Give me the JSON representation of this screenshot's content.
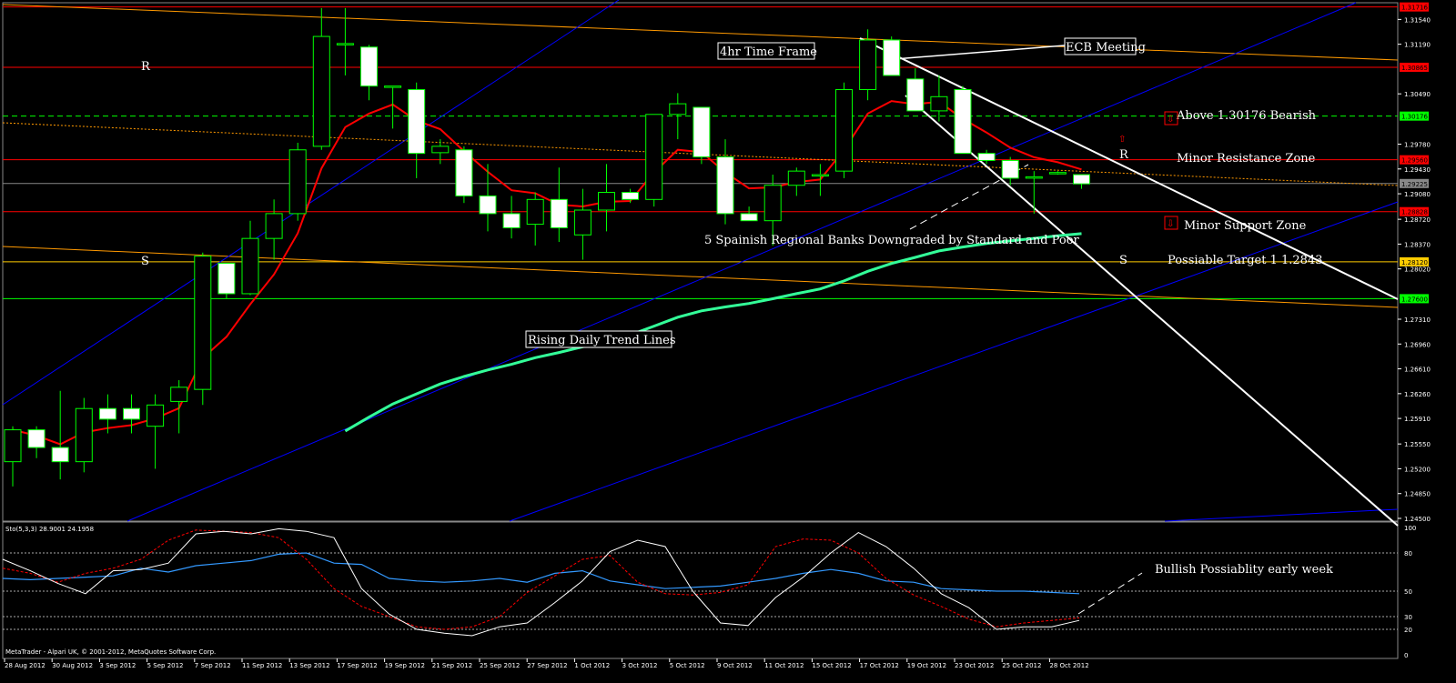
{
  "chart_data": {
    "type": "candlestick",
    "price_axis": {
      "ylim": [
        1.245,
        1.3175
      ],
      "tick_labels": [
        "1.31540",
        "1.31190",
        "1.30490",
        "1.29780",
        "1.29430",
        "1.29080",
        "1.28720",
        "1.28370",
        "1.28020",
        "1.27310",
        "1.26960",
        "1.26610",
        "1.26260",
        "1.25910",
        "1.25550",
        "1.25200",
        "1.24850",
        "1.24500"
      ],
      "tick_values": [
        1.3154,
        1.3119,
        1.3049,
        1.2978,
        1.2943,
        1.2908,
        1.2872,
        1.2837,
        1.2802,
        1.2731,
        1.2696,
        1.2661,
        1.2626,
        1.2591,
        1.2555,
        1.252,
        1.2485,
        1.245
      ],
      "level_tags": [
        {
          "text": "1.31716",
          "value": 1.31716,
          "color": "#ff0000"
        },
        {
          "text": "1.30865",
          "value": 1.30865,
          "color": "#ff0000"
        },
        {
          "text": "1.30176",
          "value": 1.30176,
          "color": "#00ff00"
        },
        {
          "text": "1.29560",
          "value": 1.2956,
          "color": "#ff0000"
        },
        {
          "text": "1.29225",
          "value": 1.29225,
          "color": "#888888"
        },
        {
          "text": "1.28828",
          "value": 1.28828,
          "color": "#ff0000"
        },
        {
          "text": "1.28120",
          "value": 1.2812,
          "color": "#ffcc00"
        },
        {
          "text": "1.27600",
          "value": 1.276,
          "color": "#00ff00"
        }
      ]
    },
    "x_tick_labels": [
      "28 Aug 2012",
      "30 Aug 2012",
      "3 Sep 2012",
      "5 Sep 2012",
      "7 Sep 2012",
      "11 Sep 2012",
      "13 Sep 2012",
      "17 Sep 2012",
      "19 Sep 2012",
      "21 Sep 2012",
      "25 Sep 2012",
      "27 Sep 2012",
      "1 Oct 2012",
      "3 Oct 2012",
      "5 Oct 2012",
      "9 Oct 2012",
      "11 Oct 2012",
      "15 Oct 2012",
      "17 Oct 2012",
      "19 Oct 2012",
      "23 Oct 2012",
      "25 Oct 2012",
      "28 Oct 2012"
    ],
    "candles": [
      {
        "o": 1.253,
        "h": 1.258,
        "l": 1.2495,
        "c": 1.2575
      },
      {
        "o": 1.2575,
        "h": 1.258,
        "l": 1.2535,
        "c": 1.255
      },
      {
        "o": 1.255,
        "h": 1.263,
        "l": 1.2505,
        "c": 1.253
      },
      {
        "o": 1.253,
        "h": 1.262,
        "l": 1.2515,
        "c": 1.2605
      },
      {
        "o": 1.2605,
        "h": 1.2625,
        "l": 1.257,
        "c": 1.259
      },
      {
        "o": 1.2605,
        "h": 1.2625,
        "l": 1.257,
        "c": 1.259
      },
      {
        "o": 1.258,
        "h": 1.2625,
        "l": 1.252,
        "c": 1.261
      },
      {
        "o": 1.2615,
        "h": 1.2645,
        "l": 1.257,
        "c": 1.2635
      },
      {
        "o": 1.2632,
        "h": 1.2825,
        "l": 1.261,
        "c": 1.282
      },
      {
        "o": 1.281,
        "h": 1.281,
        "l": 1.276,
        "c": 1.2767
      },
      {
        "o": 1.2767,
        "h": 1.287,
        "l": 1.2765,
        "c": 1.2845
      },
      {
        "o": 1.2845,
        "h": 1.29,
        "l": 1.2815,
        "c": 1.288
      },
      {
        "o": 1.288,
        "h": 1.298,
        "l": 1.287,
        "c": 1.297
      },
      {
        "o": 1.2975,
        "h": 1.317,
        "l": 1.297,
        "c": 1.313
      },
      {
        "o": 1.312,
        "h": 1.317,
        "l": 1.3075,
        "c": 1.312
      },
      {
        "o": 1.3115,
        "h": 1.3118,
        "l": 1.304,
        "c": 1.306
      },
      {
        "o": 1.306,
        "h": 1.306,
        "l": 1.3,
        "c": 1.306
      },
      {
        "o": 1.3055,
        "h": 1.3065,
        "l": 1.293,
        "c": 1.2965
      },
      {
        "o": 1.2966,
        "h": 1.2985,
        "l": 1.295,
        "c": 1.2975
      },
      {
        "o": 1.297,
        "h": 1.2975,
        "l": 1.2895,
        "c": 1.2905
      },
      {
        "o": 1.2905,
        "h": 1.295,
        "l": 1.2855,
        "c": 1.288
      },
      {
        "o": 1.288,
        "h": 1.2905,
        "l": 1.2845,
        "c": 1.286
      },
      {
        "o": 1.2865,
        "h": 1.291,
        "l": 1.2835,
        "c": 1.29
      },
      {
        "o": 1.29,
        "h": 1.2945,
        "l": 1.284,
        "c": 1.286
      },
      {
        "o": 1.285,
        "h": 1.2915,
        "l": 1.2815,
        "c": 1.2885
      },
      {
        "o": 1.2885,
        "h": 1.295,
        "l": 1.2855,
        "c": 1.291
      },
      {
        "o": 1.291,
        "h": 1.2915,
        "l": 1.2895,
        "c": 1.29
      },
      {
        "o": 1.29,
        "h": 1.302,
        "l": 1.289,
        "c": 1.302
      },
      {
        "o": 1.302,
        "h": 1.305,
        "l": 1.2985,
        "c": 1.3035
      },
      {
        "o": 1.303,
        "h": 1.303,
        "l": 1.295,
        "c": 1.296
      },
      {
        "o": 1.296,
        "h": 1.2985,
        "l": 1.2865,
        "c": 1.288
      },
      {
        "o": 1.288,
        "h": 1.289,
        "l": 1.287,
        "c": 1.287
      },
      {
        "o": 1.287,
        "h": 1.2935,
        "l": 1.2835,
        "c": 1.292
      },
      {
        "o": 1.292,
        "h": 1.2945,
        "l": 1.2905,
        "c": 1.294
      },
      {
        "o": 1.2935,
        "h": 1.295,
        "l": 1.2905,
        "c": 1.2935
      },
      {
        "o": 1.294,
        "h": 1.3065,
        "l": 1.293,
        "c": 1.3055
      },
      {
        "o": 1.3055,
        "h": 1.314,
        "l": 1.304,
        "c": 1.3125
      },
      {
        "o": 1.3125,
        "h": 1.313,
        "l": 1.3075,
        "c": 1.3075
      },
      {
        "o": 1.307,
        "h": 1.3085,
        "l": 1.303,
        "c": 1.3025
      },
      {
        "o": 1.3025,
        "h": 1.3075,
        "l": 1.301,
        "c": 1.3045
      },
      {
        "o": 1.3055,
        "h": 1.306,
        "l": 1.2965,
        "c": 1.2965
      },
      {
        "o": 1.2965,
        "h": 1.297,
        "l": 1.295,
        "c": 1.2955
      },
      {
        "o": 1.2955,
        "h": 1.296,
        "l": 1.292,
        "c": 1.293
      },
      {
        "o": 1.293,
        "h": 1.294,
        "l": 1.288,
        "c": 1.2932
      },
      {
        "o": 1.2938,
        "h": 1.294,
        "l": 1.2935,
        "c": 1.2938
      },
      {
        "o": 1.2935,
        "h": 1.2935,
        "l": 1.2915,
        "c": 1.2922
      }
    ],
    "stochastic": {
      "label": "Sto(5,3,3) 28.9001 24.1958",
      "ylim": [
        0,
        100
      ],
      "tick_labels": [
        "100",
        "80",
        "50",
        "30",
        "20",
        "0"
      ],
      "tick_values": [
        100,
        80,
        50,
        30,
        20,
        0
      ],
      "levels": [
        80,
        50,
        30,
        20
      ],
      "main": [
        75,
        66,
        56,
        48,
        66,
        67,
        72,
        95,
        97,
        95,
        99,
        97,
        92,
        52,
        32,
        20,
        17,
        15,
        22,
        25,
        41,
        58,
        81,
        90,
        85,
        50,
        25,
        23,
        45,
        61,
        80,
        96,
        85,
        68,
        48,
        37,
        20,
        22,
        22,
        27
      ],
      "signal": [
        68,
        64,
        57,
        64,
        68,
        75,
        90,
        98,
        97,
        96,
        92,
        75,
        52,
        38,
        30,
        22,
        20,
        22,
        30,
        49,
        62,
        75,
        78,
        57,
        48,
        47,
        49,
        55,
        85,
        91,
        90,
        80,
        60,
        47,
        38,
        28,
        22,
        25,
        27,
        29
      ],
      "slow": [
        60,
        59,
        60,
        61,
        62,
        68,
        65,
        70,
        72,
        74,
        79,
        80,
        72,
        71,
        60,
        58,
        57,
        58,
        60,
        57,
        64,
        66,
        58,
        55,
        52,
        53,
        54,
        57,
        60,
        64,
        67,
        64,
        58,
        57,
        52,
        51,
        50,
        50,
        49,
        48
      ]
    },
    "annotations": [
      {
        "text": "R"
      },
      {
        "text": "S"
      },
      {
        "text": "4hr Time Frame"
      },
      {
        "text": "ECB Meeting"
      },
      {
        "text": "Above 1.30176 Bearish"
      },
      {
        "text": "R"
      },
      {
        "text": "Minor Resistance Zone"
      },
      {
        "text": "Minor Support Zone"
      },
      {
        "text": "5 Spainish Regional Banks Downgraded by Standard and Poor"
      },
      {
        "text": "S"
      },
      {
        "text": "Possiable Target 1 1.2843"
      },
      {
        "text": "Rising Daily Trend Lines"
      },
      {
        "text": "Bullish Possiablity early week"
      }
    ],
    "footer": "MetaTrader - Alpari UK, © 2001-2012, MetaQuotes Software Corp."
  }
}
